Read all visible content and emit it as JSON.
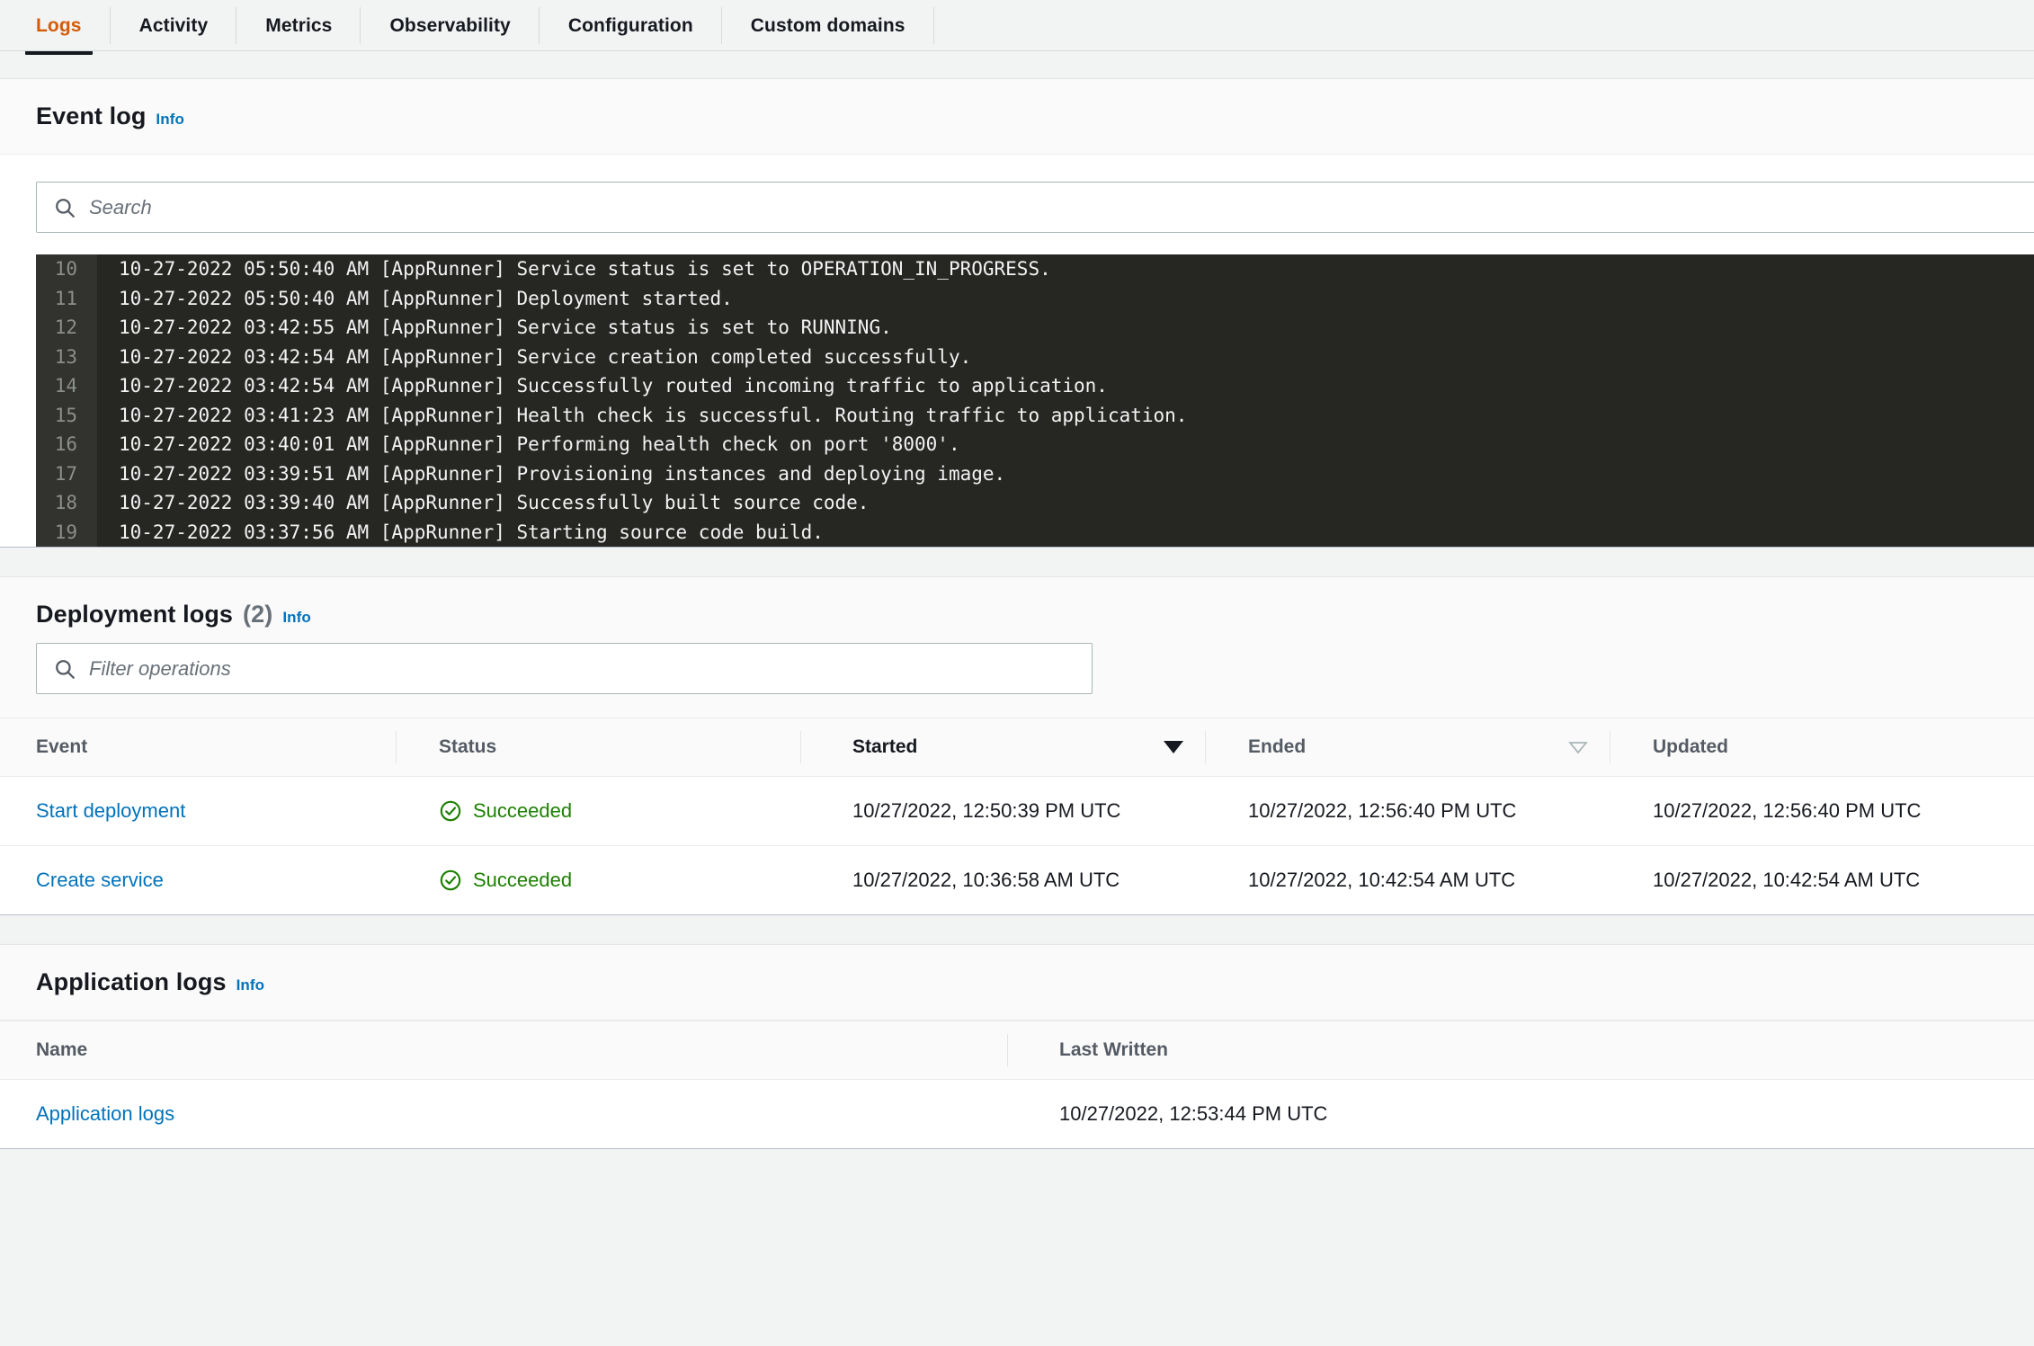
{
  "tabs": [
    {
      "label": "Logs",
      "active": true
    },
    {
      "label": "Activity",
      "active": false
    },
    {
      "label": "Metrics",
      "active": false
    },
    {
      "label": "Observability",
      "active": false
    },
    {
      "label": "Configuration",
      "active": false
    },
    {
      "label": "Custom domains",
      "active": false
    }
  ],
  "event_log": {
    "title": "Event log",
    "info_label": "Info",
    "search_placeholder": "Search",
    "search_value": "",
    "lines": [
      {
        "number": "10",
        "text": "10-27-2022 05:50:40 AM [AppRunner] Service status is set to OPERATION_IN_PROGRESS."
      },
      {
        "number": "11",
        "text": "10-27-2022 05:50:40 AM [AppRunner] Deployment started."
      },
      {
        "number": "12",
        "text": "10-27-2022 03:42:55 AM [AppRunner] Service status is set to RUNNING."
      },
      {
        "number": "13",
        "text": "10-27-2022 03:42:54 AM [AppRunner] Service creation completed successfully."
      },
      {
        "number": "14",
        "text": "10-27-2022 03:42:54 AM [AppRunner] Successfully routed incoming traffic to application."
      },
      {
        "number": "15",
        "text": "10-27-2022 03:41:23 AM [AppRunner] Health check is successful. Routing traffic to application."
      },
      {
        "number": "16",
        "text": "10-27-2022 03:40:01 AM [AppRunner] Performing health check on port '8000'."
      },
      {
        "number": "17",
        "text": "10-27-2022 03:39:51 AM [AppRunner] Provisioning instances and deploying image."
      },
      {
        "number": "18",
        "text": "10-27-2022 03:39:40 AM [AppRunner] Successfully built source code."
      },
      {
        "number": "19",
        "text": "10-27-2022 03:37:56 AM [AppRunner] Starting source code build."
      }
    ]
  },
  "deployment_logs": {
    "title": "Deployment logs",
    "count": "(2)",
    "info_label": "Info",
    "filter_placeholder": "Filter operations",
    "filter_value": "",
    "columns": [
      {
        "label": "Event",
        "sort": "none"
      },
      {
        "label": "Status",
        "sort": "none"
      },
      {
        "label": "Started",
        "sort": "desc-active"
      },
      {
        "label": "Ended",
        "sort": "desc-inactive"
      },
      {
        "label": "Updated",
        "sort": "none"
      }
    ],
    "rows": [
      {
        "event": "Start deployment",
        "status": "Succeeded",
        "started": "10/27/2022, 12:50:39 PM UTC",
        "ended": "10/27/2022, 12:56:40 PM UTC",
        "updated": "10/27/2022, 12:56:40 PM UTC"
      },
      {
        "event": "Create service",
        "status": "Succeeded",
        "started": "10/27/2022, 10:36:58 AM UTC",
        "ended": "10/27/2022, 10:42:54 AM UTC",
        "updated": "10/27/2022, 10:42:54 AM UTC"
      }
    ]
  },
  "application_logs": {
    "title": "Application logs",
    "info_label": "Info",
    "columns": [
      {
        "label": "Name"
      },
      {
        "label": "Last Written"
      }
    ],
    "rows": [
      {
        "name": "Application logs",
        "last_written": "10/27/2022, 12:53:44 PM UTC"
      }
    ]
  },
  "colors": {
    "active_tab": "#d45b07",
    "link": "#0073bb",
    "success": "#1d8102",
    "console_bg": "#262623",
    "gutter_bg": "#32322e",
    "page_bg": "#f2f3f3"
  }
}
